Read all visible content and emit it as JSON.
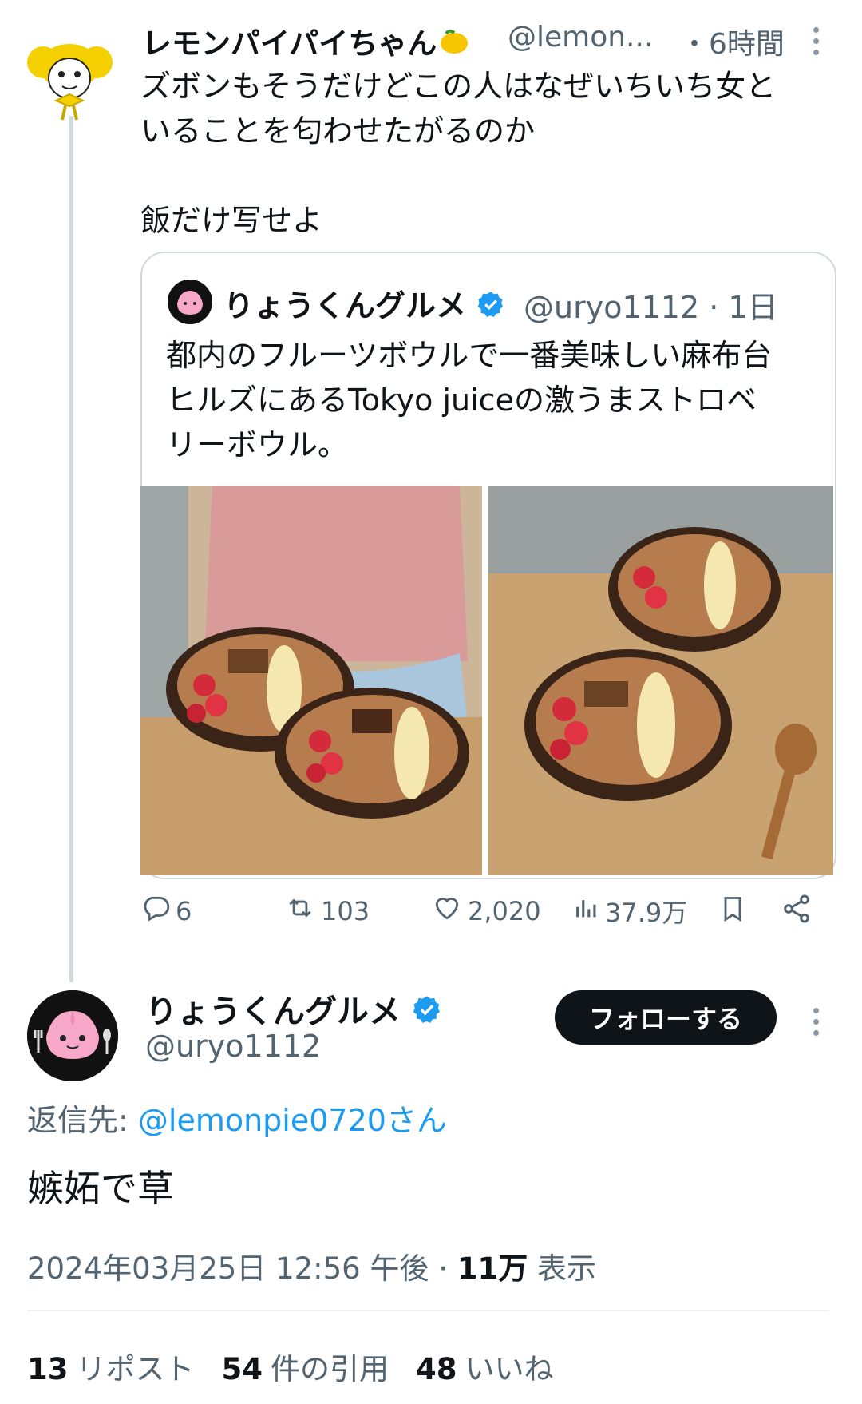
{
  "original_tweet": {
    "display_name": "レモンパイパイちゃん",
    "name_emoji_icon": "lemon-icon",
    "handle": "@lemon...",
    "time": "・6時間",
    "body": "ズボンもそうだけどこの人はなぜいちいち女と\nいることを匂わせたがるのか\n\n飯だけ写せよ"
  },
  "quoted_tweet": {
    "display_name": "りょうくんグルメ",
    "handle": "@uryo1112",
    "time": "· 1日",
    "body": "都内のフルーツボウルで一番美味しい麻布台\nヒルズにあるTokyo juiceの激うまストロベ\nリーボウル。",
    "images": [
      "fruit-bowl-photo-1",
      "fruit-bowl-photo-2"
    ]
  },
  "actions": {
    "reply_count": "6",
    "repost_count": "103",
    "like_count": "2,020",
    "views_count": "37.9万"
  },
  "reply_tweet": {
    "display_name": "りょうくんグルメ",
    "handle": "@uryo1112",
    "follow_label": "フォローする",
    "reply_to_prefix": "返信先: ",
    "reply_to_handle": "@lemonpie0720さん",
    "body": "嫉妬で草",
    "timestamp": "2024年03月25日 12:56 午後 · ",
    "views_value": "11万",
    "views_suffix": " 表示",
    "stats": {
      "reposts_value": "13",
      "reposts_label": "リポスト",
      "quotes_value": "54",
      "quotes_label": "件の引用",
      "likes_value": "48",
      "likes_label": "いいね"
    }
  },
  "colors": {
    "text_primary": "#0f1419",
    "text_secondary": "#536471",
    "link_blue": "#1d9bf0",
    "verified_blue": "#1d9bf0",
    "border": "#cfd9de"
  }
}
